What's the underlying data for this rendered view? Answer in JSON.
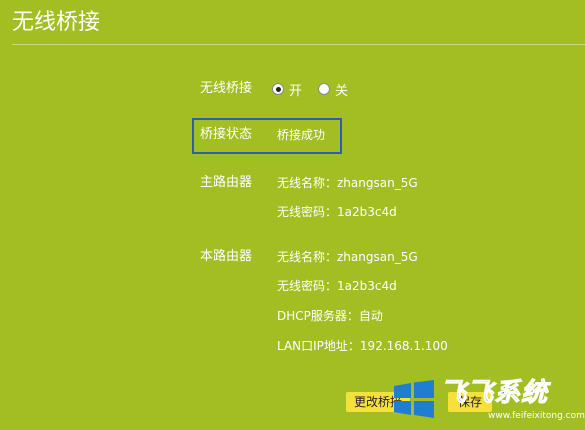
{
  "header": {
    "title": "无线桥接"
  },
  "bridge": {
    "label": "无线桥接",
    "options": [
      {
        "label": "开",
        "checked": true
      },
      {
        "label": "关",
        "checked": false
      }
    ]
  },
  "status": {
    "label": "桥接状态",
    "value": "桥接成功",
    "highlight_color": "#2a5fb0"
  },
  "main_router": {
    "label": "主路由器",
    "ssid": "无线名称：zhangsan_5G",
    "password": "无线密码：1a2b3c4d"
  },
  "this_router": {
    "label": "本路由器",
    "ssid": "无线名称：zhangsan_5G",
    "password": "无线密码：1a2b3c4d",
    "dhcp": "DHCP服务器：自动",
    "lan_ip": "LAN口IP地址：192.168.1.100"
  },
  "actions": {
    "change_label": "更改桥接",
    "save_label": "保存"
  },
  "watermark": {
    "brand": "飞飞系统",
    "url": "www.feifeixitong.com",
    "logo_icon": "windows-logo-icon"
  },
  "colors": {
    "background": "#a2be22",
    "button": "#f5e13a",
    "text": "#ffffff"
  }
}
